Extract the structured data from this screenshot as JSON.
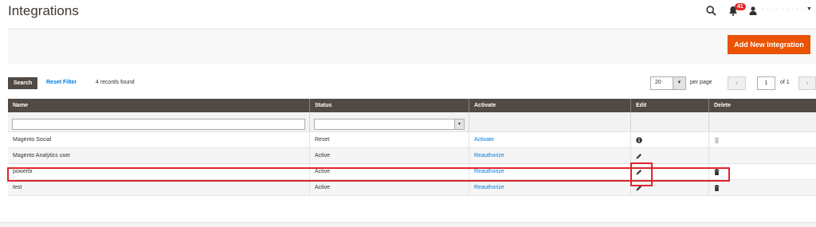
{
  "header": {
    "title": "Integrations",
    "notification_count": "41",
    "user_name": "· · · · ·  · · · ·"
  },
  "action_bar": {
    "add_label": "Add New Integration"
  },
  "toolbar": {
    "search_label": "Search",
    "reset_label": "Reset Filter",
    "records_found": "4 records found",
    "page_size": "20",
    "per_page_label": "per page",
    "current_page": "1",
    "of_total": "of 1"
  },
  "grid": {
    "columns": [
      "Name",
      "Status",
      "Activate",
      "Edit",
      "Delete"
    ],
    "rows": [
      {
        "name": "Magento Social",
        "status": "Reset",
        "activate": "Activate",
        "edit_icon": "info-icon",
        "delete_icon": "trash-icon-disabled"
      },
      {
        "name": "Magento Analytics user",
        "status": "Active",
        "activate": "Reauthorize",
        "edit_icon": "pencil-icon",
        "delete_icon": "none"
      },
      {
        "name": "powerbi",
        "status": "Active",
        "activate": "Reauthorize",
        "edit_icon": "pencil-icon",
        "delete_icon": "trash-icon"
      },
      {
        "name": "test",
        "status": "Active",
        "activate": "Reauthorize",
        "edit_icon": "pencil-icon",
        "delete_icon": "trash-icon"
      }
    ]
  },
  "colors": {
    "accent": "#eb5202",
    "grid_header": "#514943",
    "link": "#007bdb",
    "highlight": "#e0242b"
  }
}
